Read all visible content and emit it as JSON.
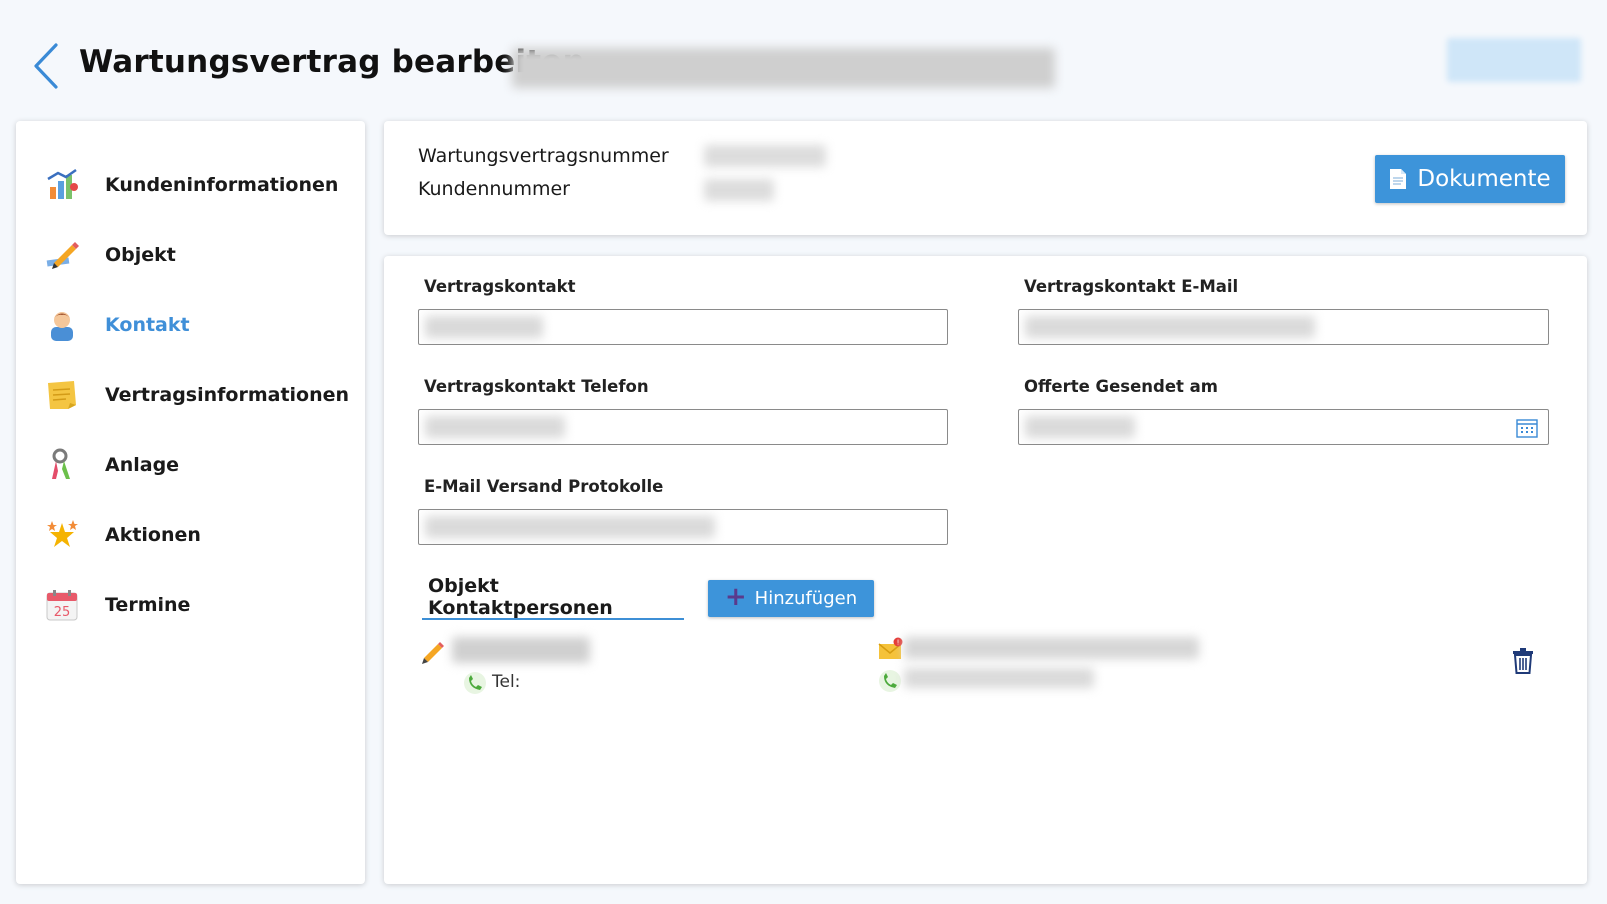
{
  "header": {
    "title": "Wartungsvertrag bearbeiten"
  },
  "sidebar": {
    "items": [
      {
        "label": "Kundeninformationen",
        "icon": "customer-info-icon"
      },
      {
        "label": "Objekt",
        "icon": "pencil-ruler-icon"
      },
      {
        "label": "Kontakt",
        "icon": "person-icon",
        "active": true
      },
      {
        "label": "Vertragsinformationen",
        "icon": "sticky-note-icon"
      },
      {
        "label": "Anlage",
        "icon": "keys-icon"
      },
      {
        "label": "Aktionen",
        "icon": "stars-icon"
      },
      {
        "label": "Termine",
        "icon": "calendar-icon"
      }
    ]
  },
  "info": {
    "contract_number_label": "Wartungsvertragsnummer",
    "customer_number_label": "Kundennummer",
    "documents_button": "Dokumente"
  },
  "form": {
    "contact_label": "Vertragskontakt",
    "contact_email_label": "Vertragskontakt E-Mail",
    "contact_phone_label": "Vertragskontakt Telefon",
    "offer_sent_label": "Offerte Gesendet am",
    "email_protocols_label": "E-Mail Versand Protokolle"
  },
  "contacts": {
    "tab_label": "Objekt Kontaktpersonen",
    "add_button": "Hinzufügen",
    "tel_label": "Tel:"
  },
  "colors": {
    "accent": "#3d94da",
    "active_nav": "#3f8fd8",
    "background": "#f5f8fc"
  }
}
